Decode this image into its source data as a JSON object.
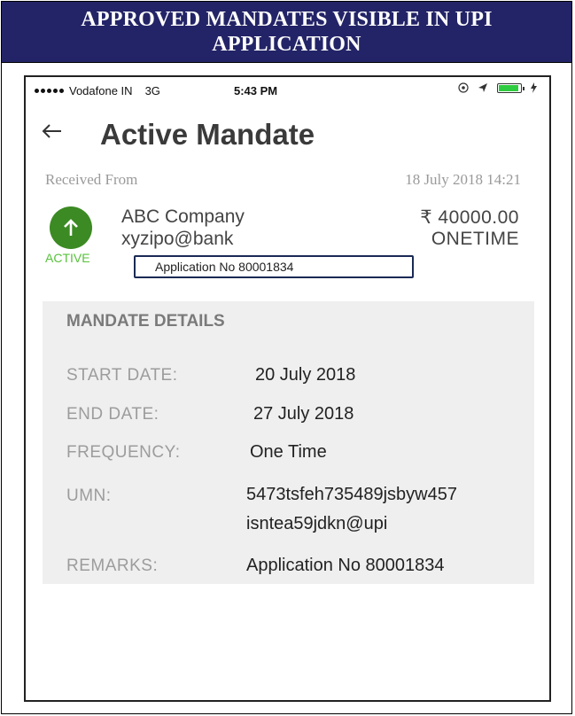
{
  "banner": {
    "title": "APPROVED MANDATES VISIBLE IN UPI APPLICATION"
  },
  "status_bar": {
    "carrier": "Vodafone IN",
    "network": "3G",
    "time": "5:43 PM"
  },
  "header": {
    "back_icon": "back-arrow-icon",
    "title": "Active Mandate"
  },
  "received": {
    "label": "Received From",
    "datetime": "18 July 2018 14:21"
  },
  "mandate": {
    "status": "ACTIVE",
    "status_color": "#3c8a23",
    "payee_name": "ABC Company",
    "payee_vpa": "xyzipo@bank",
    "amount": "₹ 40000.00",
    "type": "ONETIME",
    "application_no": "Application No 80001834"
  },
  "details": {
    "heading": "MANDATE DETAILS",
    "start_date": {
      "label": "START DATE:",
      "value": "20 July 2018"
    },
    "end_date": {
      "label": "END DATE:",
      "value": "27 July 2018"
    },
    "frequency": {
      "label": "FREQUENCY:",
      "value": "One Time"
    },
    "umn": {
      "label": "UMN:",
      "value_line1": "5473tsfeh735489jsbyw457",
      "value_line2": "isntea59jdkn@upi"
    },
    "remarks": {
      "label": "REMARKS:",
      "value": "Application No 80001834"
    }
  }
}
